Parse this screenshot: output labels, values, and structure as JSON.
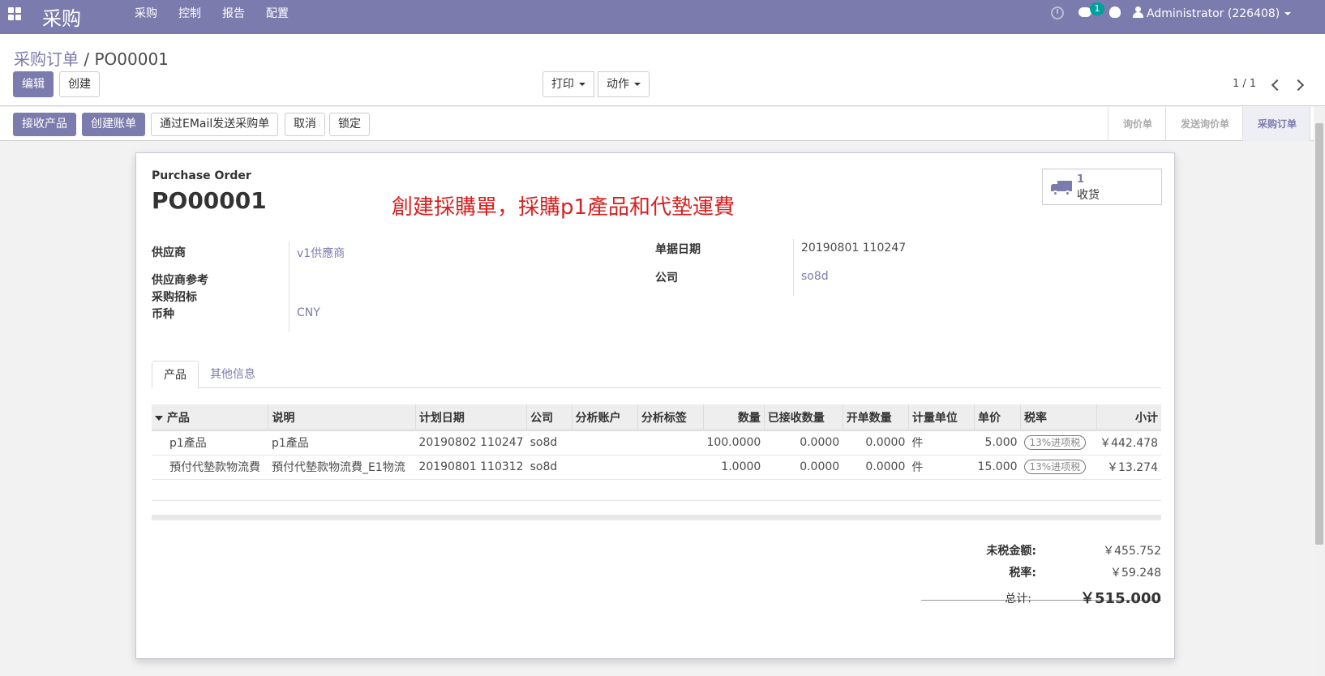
{
  "topbar": {
    "app_name": "采购",
    "menu": [
      "采购",
      "控制",
      "报告",
      "配置"
    ],
    "chat_badge": "1",
    "user": "Administrator (226408)"
  },
  "control": {
    "breadcrumb_parent": "采购订单",
    "breadcrumb_sep": "/",
    "breadcrumb_current": "PO00001",
    "edit": "编辑",
    "create": "创建",
    "print": "打印",
    "action": "动作",
    "pager": "1 / 1"
  },
  "statusbar": {
    "buttons": [
      "接收产品",
      "创建账单",
      "通过EMail发送采购单",
      "取消",
      "锁定"
    ],
    "stages": [
      "询价单",
      "发送询价单",
      "采购订单"
    ]
  },
  "sheet": {
    "doc_type": "Purchase Order",
    "doc_number": "PO00001",
    "annotation": "創建採購單，採購p1產品和代墊運費",
    "smart_count": "1",
    "smart_label": "收货",
    "fields": {
      "vendor_label": "供应商",
      "vendor_value": "v1供應商",
      "vendor_ref_label": "供应商参考",
      "tender_label": "采购招标",
      "currency_label": "币种",
      "currency_value": "CNY",
      "date_label": "单据日期",
      "date_value": "20190801 110247",
      "company_label": "公司",
      "company_value": "so8d"
    },
    "tabs": [
      "产品",
      "其他信息"
    ],
    "columns": [
      "产品",
      "说明",
      "计划日期",
      "公司",
      "分析账户",
      "分析标签",
      "数量",
      "已接收数量",
      "开单数量",
      "计量单位",
      "单价",
      "税率",
      "小计"
    ],
    "rows": [
      [
        "p1產品",
        "p1產品",
        "20190802 110247",
        "so8d",
        "",
        "",
        "100.0000",
        "0.0000",
        "0.0000",
        "件",
        "5.000",
        "13%进项税",
        "￥442.478"
      ],
      [
        "預付代墊款物流費",
        "預付代墊款物流費_E1物流",
        "20190801 110312",
        "so8d",
        "",
        "",
        "1.0000",
        "0.0000",
        "0.0000",
        "件",
        "15.000",
        "13%进项税",
        "￥13.274"
      ]
    ],
    "totals": {
      "untaxed_label": "未税金额:",
      "untaxed_value": "￥455.752",
      "tax_label": "税率:",
      "tax_value": "￥59.248",
      "total_label": "总计:",
      "total_value": "￥515.000"
    }
  },
  "colors": {
    "brand": "#7c7bad",
    "annotation": "#d82020",
    "badge": "#00a09d"
  }
}
